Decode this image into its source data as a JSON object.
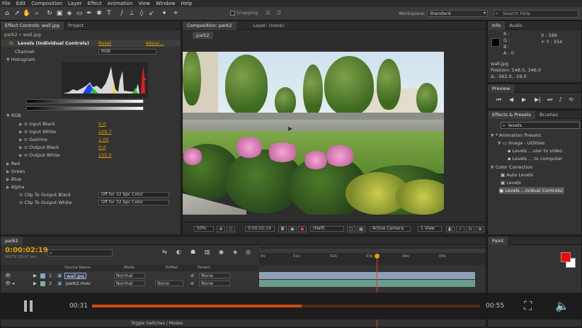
{
  "menu": [
    "File",
    "Edit",
    "Composition",
    "Layer",
    "Effect",
    "Animation",
    "View",
    "Window",
    "Help"
  ],
  "toolbar": {
    "snapping_label": "Snapping",
    "workspace_label": "Workspace:",
    "workspace_value": "Standard",
    "search_placeholder": "Search Help"
  },
  "effect_controls": {
    "tab_label": "Effect Controls: wall.jpg",
    "project_tab": "Project",
    "header": "park2 • wall.jpg",
    "effect_name": "Levels (Individual Controls)",
    "reset": "Reset",
    "about": "About...",
    "channel_label": "Channel:",
    "channel_value": "RGB",
    "histogram_label": "Histogram",
    "rgb_label": "RGB",
    "params": [
      {
        "label": "Input Black",
        "value": "0.0"
      },
      {
        "label": "Input White",
        "value": "229.7"
      },
      {
        "label": "Gamma",
        "value": "1.00"
      },
      {
        "label": "Output Black",
        "value": "0.0"
      },
      {
        "label": "Output White",
        "value": "255.0"
      }
    ],
    "channels": [
      "Red",
      "Green",
      "Blue",
      "Alpha"
    ],
    "clip_black_label": "Clip To Output Black",
    "clip_black_value": "Off for 32 bpc Color",
    "clip_white_label": "Clip To Output White",
    "clip_white_value": "Off for 32 bpc Color"
  },
  "composition": {
    "tab_label": "Composition: park2",
    "layer_tab": "Layer: (none)",
    "breadcrumb": "park2",
    "zoom": "50%",
    "timecode": "0;00;02;19",
    "resolution": "(Half)",
    "camera": "Active Camera",
    "views": "1 View"
  },
  "info": {
    "tab": "Info",
    "audio_tab": "Audio",
    "r": "R :",
    "g": "G :",
    "b": "B :",
    "a": "A : 0",
    "x": "X : 586",
    "y": "+ Y : 354",
    "file": "wall.jpg",
    "position": "Position: 548.0, 346.0",
    "delta": "Δ: -362.0, -18.0"
  },
  "preview": {
    "tab": "Preview"
  },
  "effects_presets": {
    "tab": "Effects & Presets",
    "brushes_tab": "Brushes",
    "search_value": "levels",
    "items": [
      {
        "label": "* Animation Presets",
        "indent": 0
      },
      {
        "label": "Image - Utilities",
        "indent": 1
      },
      {
        "label": "Levels ...uter to video",
        "indent": 2
      },
      {
        "label": "Levels ... to computer",
        "indent": 2
      },
      {
        "label": "Color Correction",
        "indent": 0
      },
      {
        "label": "Auto Levels",
        "indent": 1
      },
      {
        "label": "Levels",
        "indent": 1
      },
      {
        "label": "Levels ...ividual Controls)",
        "indent": 1
      }
    ]
  },
  "paint": {
    "tab": "Paint",
    "fg_color": "#ff0000",
    "bg_color": "#ffffff"
  },
  "timeline": {
    "tab": "park2",
    "timecode": "0:00:02:19",
    "fps": "00079 (29.97 fps)",
    "search_placeholder": "",
    "col_source": "Source Name",
    "col_mode": "Mode",
    "col_trkmat": "TrkMat",
    "col_parent": "Parent",
    "ruler": [
      "0s",
      "01s",
      "02s",
      "03s",
      "04s",
      "05s"
    ],
    "layers": [
      {
        "num": "1",
        "name": "wall.jpg",
        "mode": "Normal",
        "trkmat": "",
        "parent": "None"
      },
      {
        "num": "2",
        "name": "park2.mov",
        "mode": "Normal",
        "trkmat": "None",
        "parent": "None"
      }
    ],
    "toggle_label": "Toggle Switches / Modes",
    "playhead_fraction": 0.52
  },
  "video_player": {
    "elapsed": "00:31",
    "remaining": "00:55",
    "progress": 0.54
  }
}
